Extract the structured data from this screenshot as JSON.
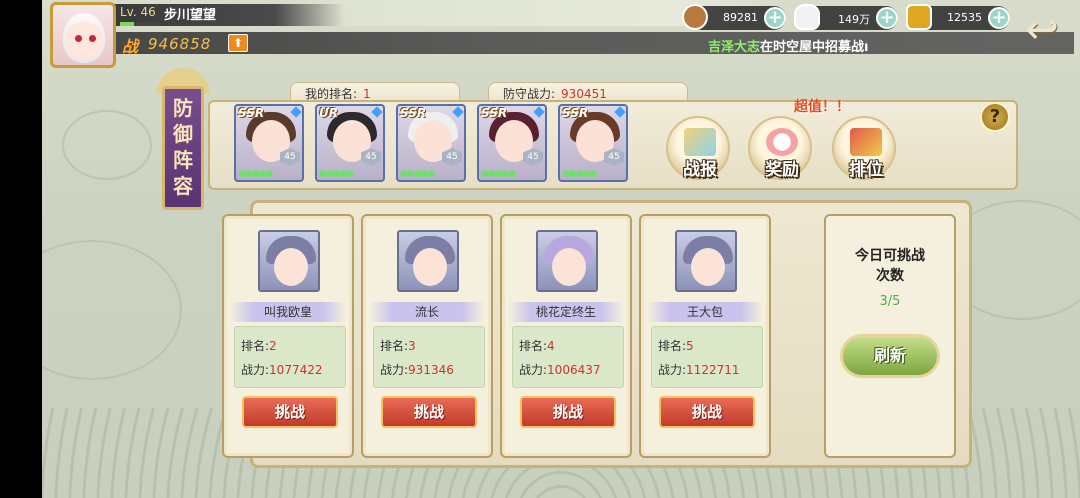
{
  "player": {
    "level": "Lv. 46",
    "name": "步川望望",
    "power_icon": "战",
    "power": "946858",
    "exp_fraction": 0.35
  },
  "ticker": {
    "highlight": "吉泽大志",
    "text": "在时空屋中招募战ı"
  },
  "resources": [
    {
      "icon": "coin-icon",
      "value": "89281",
      "color": "#b87a3c"
    },
    {
      "icon": "rice-ball-icon",
      "value": "149万",
      "color": "#f2f2f2"
    },
    {
      "icon": "gold-bar-icon",
      "value": "12535",
      "color": "#e0a722"
    }
  ],
  "side_tag": "防御阵容",
  "defense": {
    "my_rank_label": "我的排名:",
    "my_rank": "1",
    "def_power_label": "防守战力:",
    "def_power": "930451",
    "heroes": [
      {
        "rarity": "SSR",
        "level": "45",
        "hair": "#5a3a2a",
        "stars": "●●●●●"
      },
      {
        "rarity": "UR",
        "level": "45",
        "hair": "#2d2a2e",
        "stars": "●●●●●"
      },
      {
        "rarity": "SSR",
        "level": "45",
        "hair": "#efefef",
        "stars": "●●●●●"
      },
      {
        "rarity": "SSR",
        "level": "45",
        "hair": "#5a2030",
        "stars": "●●●●●"
      },
      {
        "rarity": "SSR",
        "level": "45",
        "hair": "#6a3a28",
        "stars": "●●●●●"
      }
    ]
  },
  "actions": {
    "super_label": "超值！！",
    "report": "战报",
    "reward": "奖励",
    "ranking": "排位",
    "help": "?"
  },
  "opponents": [
    {
      "name": "叫我欧皇",
      "rank_label": "排名:",
      "rank": "2",
      "power_label": "战力:",
      "power": "1077422",
      "challenge": "挑战"
    },
    {
      "name": "流长",
      "rank_label": "排名:",
      "rank": "3",
      "power_label": "战力:",
      "power": "931346",
      "challenge": "挑战"
    },
    {
      "name": "桃花定终生",
      "rank_label": "排名:",
      "rank": "4",
      "power_label": "战力:",
      "power": "1006437",
      "challenge": "挑战"
    },
    {
      "name": "王大包",
      "rank_label": "排名:",
      "rank": "5",
      "power_label": "战力:",
      "power": "1122711",
      "challenge": "挑战"
    }
  ],
  "challenges": {
    "title_line1": "今日可挑战",
    "title_line2": "次数",
    "count": "3/5",
    "refresh": "刷新"
  }
}
